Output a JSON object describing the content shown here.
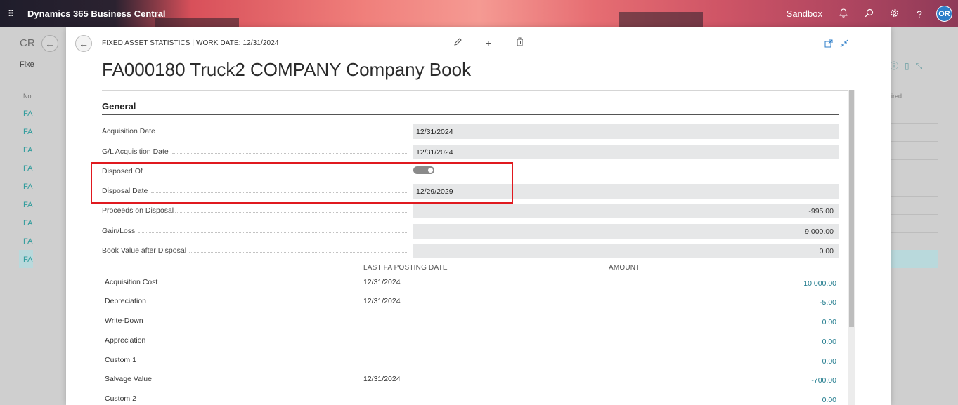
{
  "topbar": {
    "waffle_glyph": "⠿",
    "app_title": "Dynamics 365 Business Central",
    "environment": "Sandbox",
    "bell_glyph": "🔔",
    "search_glyph": "⌕",
    "settings_glyph": "⚙",
    "help_glyph": "?",
    "avatar_initials": "OR"
  },
  "background_page": {
    "title": "CR",
    "tab_label": "Fixe",
    "column_header": "No.",
    "row_prefix": "FA",
    "right_column_header": "ired"
  },
  "dialog": {
    "back_glyph": "←",
    "breadcrumb": "FIXED ASSET STATISTICS | WORK DATE: 12/31/2024",
    "edit_glyph": "✎",
    "new_glyph": "+",
    "delete_glyph": "🗑",
    "title": "FA000180 Truck2 COMPANY Company Book",
    "section_title": "General",
    "fields": {
      "acquisition_date_label": "Acquisition Date",
      "acquisition_date_value": "12/31/2024",
      "gl_acquisition_date_label": "G/L Acquisition Date",
      "gl_acquisition_date_value": "12/31/2024",
      "disposed_of_label": "Disposed Of",
      "disposal_date_label": "Disposal Date",
      "disposal_date_value": "12/29/2029",
      "proceeds_label": "Proceeds on Disposal",
      "proceeds_value": "-995.00",
      "gain_loss_label": "Gain/Loss",
      "gain_loss_value": "9,000.00",
      "book_value_label": "Book Value after Disposal",
      "book_value_value": "0.00"
    },
    "table": {
      "col_last_posting": "LAST FA POSTING DATE",
      "col_amount": "AMOUNT",
      "rows": [
        {
          "label": "Acquisition Cost",
          "date": "12/31/2024",
          "amount": "10,000.00"
        },
        {
          "label": "Depreciation",
          "date": "12/31/2024",
          "amount": "-5.00"
        },
        {
          "label": "Write-Down",
          "date": "",
          "amount": "0.00"
        },
        {
          "label": "Appreciation",
          "date": "",
          "amount": "0.00"
        },
        {
          "label": "Custom 1",
          "date": "",
          "amount": "0.00"
        },
        {
          "label": "Salvage Value",
          "date": "12/31/2024",
          "amount": "-700.00"
        },
        {
          "label": "Custom 2",
          "date": "",
          "amount": "0.00"
        }
      ]
    }
  }
}
